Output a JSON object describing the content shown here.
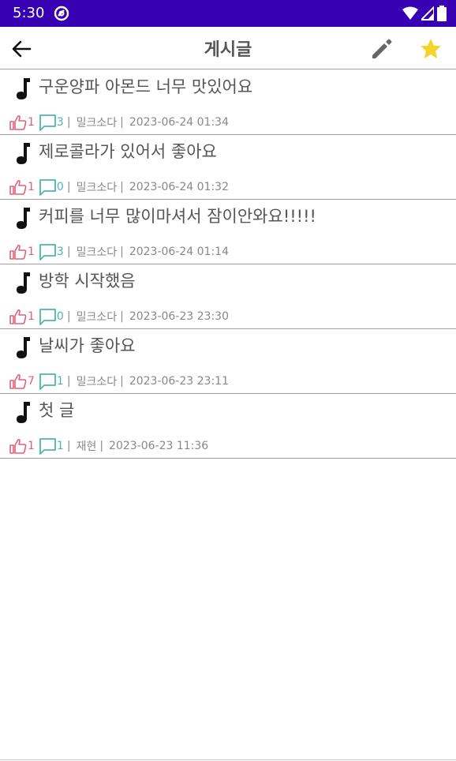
{
  "status_bar": {
    "time": "5:30",
    "icons": [
      "app-notification-icon",
      "wifi-icon",
      "signal-icon",
      "battery-icon"
    ]
  },
  "app_bar": {
    "title": "게시글",
    "back_icon": "arrow-back-icon",
    "edit_icon": "pencil-icon",
    "favorite_icon": "star-icon"
  },
  "colors": {
    "status_bar": "#3700b3",
    "title_text": "#555555",
    "like": "#e0607a",
    "comment": "#4db6ac",
    "favorite_star": "#f5d32a"
  },
  "posts": [
    {
      "title": "구운양파 아몬드 너무 맛있어요",
      "likes": "1",
      "comments": "3",
      "author": "밀크소다",
      "date": "2023-06-24 01:34"
    },
    {
      "title": "제로콜라가 있어서 좋아요",
      "likes": "1",
      "comments": "0",
      "author": "밀크소다",
      "date": "2023-06-24 01:32"
    },
    {
      "title": "커피를 너무 많이마셔서 잠이안와요!!!!!",
      "likes": "1",
      "comments": "3",
      "author": "밀크소다",
      "date": "2023-06-24 01:14"
    },
    {
      "title": "방학 시작했음",
      "likes": "1",
      "comments": "0",
      "author": "밀크소다",
      "date": "2023-06-23 23:30"
    },
    {
      "title": "날씨가 좋아요",
      "likes": "7",
      "comments": "1",
      "author": "밀크소다",
      "date": "2023-06-23 23:11"
    },
    {
      "title": "첫 글",
      "likes": "1",
      "comments": "1",
      "author": "재현",
      "date": "2023-06-23 11:36"
    }
  ]
}
